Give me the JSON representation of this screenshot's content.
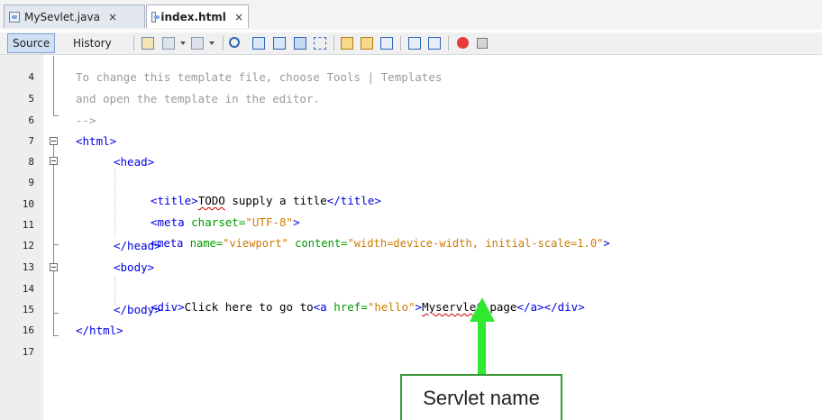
{
  "tabs": [
    {
      "label": "MySevlet.java",
      "close": "×",
      "active": false
    },
    {
      "label": "index.html",
      "close": "×",
      "active": true
    }
  ],
  "toolbar": {
    "source_label": "Source",
    "history_label": "History"
  },
  "line_numbers": [
    "4",
    "5",
    "6",
    "7",
    "8",
    "9",
    "10",
    "11",
    "12",
    "13",
    "14",
    "15",
    "16",
    "17"
  ],
  "code": {
    "l4": "To change this template file, choose Tools | Templates",
    "l5": "and open the template in the editor.",
    "l6": "-->",
    "l7": "<html>",
    "l8": "<head>",
    "l9": {
      "open": "<title>",
      "text": "TODO",
      "rest": " supply a title",
      "close": "</title>"
    },
    "l10": {
      "open": "<meta ",
      "attr": "charset=",
      "val": "\"UTF-8\"",
      "close": ">"
    },
    "l11": {
      "open": "<meta ",
      "attr1": "name=",
      "val1": "\"viewport\"",
      "attr2": " content=",
      "val2": "\"width=device-width, initial-scale=1.0\"",
      "close": ">"
    },
    "l12": "</head>",
    "l13": "<body>",
    "l14": {
      "open": "<div>",
      "text1": "Click here to go to",
      "a_open": "<a ",
      "attr": "href=",
      "val": "\"hello\"",
      "gt": ">",
      "text2": "Myservlet",
      "text3": " page",
      "a_close": "</a>",
      "close": "</div>"
    },
    "l15": "</body>",
    "l16": "</html>"
  },
  "annotation": {
    "label": "Servlet name",
    "color": "#2fe82f"
  }
}
